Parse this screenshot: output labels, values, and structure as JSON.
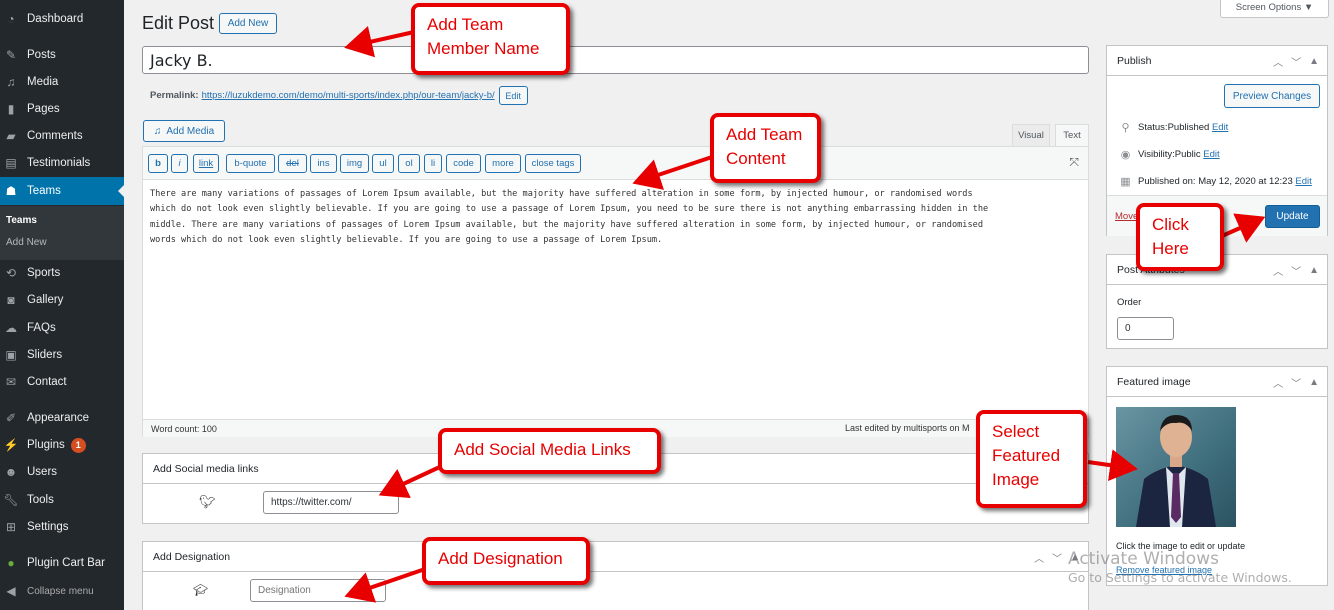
{
  "sidebar": {
    "items": [
      {
        "label": "Dashboard",
        "icon": "dashboard-icon"
      },
      {
        "label": "Posts",
        "icon": "pin-icon"
      },
      {
        "label": "Media",
        "icon": "media-icon"
      },
      {
        "label": "Pages",
        "icon": "pages-icon"
      },
      {
        "label": "Comments",
        "icon": "comment-icon"
      },
      {
        "label": "Testimonials",
        "icon": "testimonial-icon"
      },
      {
        "label": "Teams",
        "icon": "groups-icon",
        "active": true
      },
      {
        "label": "Sports",
        "icon": "sync-icon"
      },
      {
        "label": "Gallery",
        "icon": "camera-icon"
      },
      {
        "label": "FAQs",
        "icon": "chat-bubbles-icon"
      },
      {
        "label": "Sliders",
        "icon": "slides-icon"
      },
      {
        "label": "Contact",
        "icon": "envelope-icon"
      },
      {
        "label": "Appearance",
        "icon": "paintbrush-icon"
      },
      {
        "label": "Plugins",
        "icon": "plug-icon",
        "badge": "1"
      },
      {
        "label": "Users",
        "icon": "user-icon"
      },
      {
        "label": "Tools",
        "icon": "wrench-icon"
      },
      {
        "label": "Settings",
        "icon": "settings-icon"
      },
      {
        "label": "Plugin Cart Bar",
        "icon": "leaf-icon"
      }
    ],
    "submenu": [
      {
        "label": "Teams",
        "current": true
      },
      {
        "label": "Add New"
      }
    ],
    "collapse_label": "Collapse menu"
  },
  "header": {
    "title": "Edit Post",
    "add_new_label": "Add New",
    "screen_options_label": "Screen Options ▼"
  },
  "post": {
    "title": "Jacky B.",
    "permalink_label": "Permalink:",
    "permalink_url": "https://luzukdemo.com/demo/multi-sports/index.php/our-team/jacky-b/",
    "permalink_edit": "Edit"
  },
  "editor": {
    "add_media_label": "Add Media",
    "tabs": [
      "Visual",
      "Text"
    ],
    "active_tab": "Text",
    "quicktags": [
      "b",
      "i",
      "link",
      "b-quote",
      "del",
      "ins",
      "img",
      "ul",
      "ol",
      "li",
      "code",
      "more",
      "close tags"
    ],
    "content": "There are many variations of passages of Lorem Ipsum available, but the majority have suffered alteration in some form, by injected humour, or randomised words\nwhich do not look even slightly believable. If you are going to use a passage of Lorem Ipsum, you need to be sure there is not anything embarrassing hidden in the\nmiddle. There are many variations of passages of Lorem Ipsum available, but the majority have suffered alteration in some form, by injected humour, or randomised\nwords which do not look even slightly believable. If you are going to use a passage of Lorem Ipsum.",
    "word_count": "Word count: 100",
    "last_edited": "Last edited by multisports on M"
  },
  "social_box": {
    "title": "Add Social media links",
    "twitter_value": "https://twitter.com/"
  },
  "designation_box": {
    "title": "Add Designation",
    "placeholder": "Designation"
  },
  "publish": {
    "title": "Publish",
    "preview_label": "Preview Changes",
    "status_label": "Status: ",
    "status_value": "Published",
    "visibility_label": "Visibility: ",
    "visibility_value": "Public",
    "published_on": "Published on: May 12, 2020 at 12:23",
    "edit_link": "Edit",
    "trash_label": "Move to Trash",
    "update_label": "Update"
  },
  "attributes": {
    "title": "Post Attributes",
    "order_label": "Order",
    "order_value": "0"
  },
  "featured": {
    "title": "Featured image",
    "hint": "Click the image to edit or update",
    "remove_label": "Remove featured image"
  },
  "callouts": {
    "name": "Add Team\nMember Name",
    "content": "Add Team\nContent",
    "click": "Click\nHere",
    "social": "Add Social Media Links",
    "image": "Select\nFeatured\nImage",
    "designation": "Add Designation"
  },
  "watermark": {
    "line1": "Activate Windows",
    "line2": "Go to Settings to activate Windows."
  },
  "colors": {
    "accent": "#2271b1",
    "sidebar_bg": "#23282d",
    "active_menu": "#0073aa",
    "callout_red": "#e80000",
    "badge": "#d54e21"
  }
}
